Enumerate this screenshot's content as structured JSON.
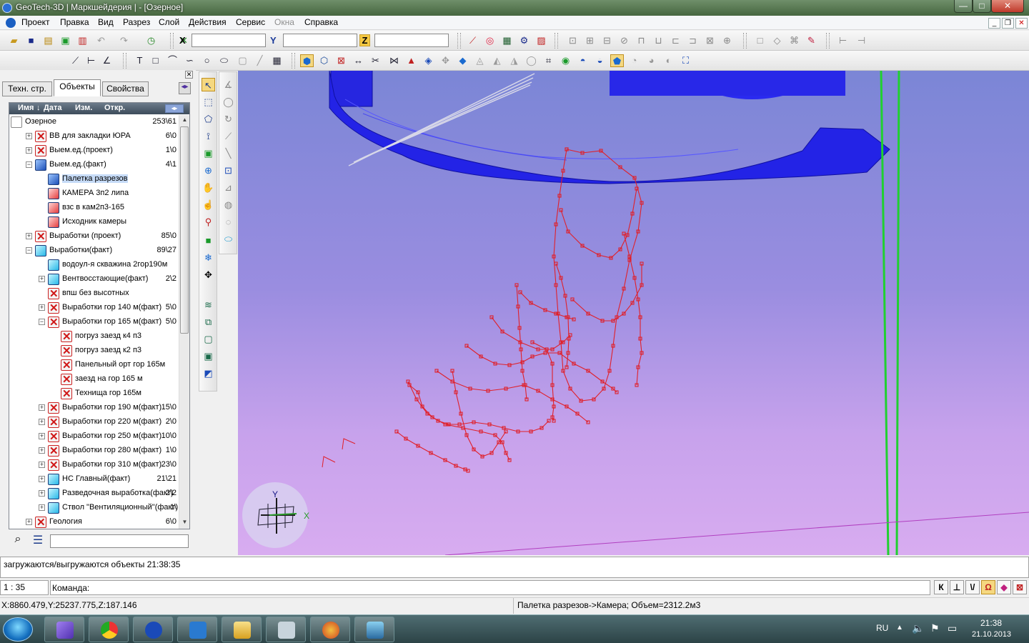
{
  "window": {
    "title": "GeoTech-3D | Маркшейдерия | - [Озерное]",
    "minimize": "—",
    "maximize": "□",
    "close": "✕"
  },
  "menu": {
    "items": [
      "Проект",
      "Правка",
      "Вид",
      "Разрез",
      "Слой",
      "Действия",
      "Сервис",
      "Окна",
      "Справка"
    ],
    "disabled": [
      "Окна"
    ],
    "mdi_min": "_",
    "mdi_restore": "❐",
    "mdi_close": "✕"
  },
  "coords": {
    "x_label": "X",
    "y_label": "Y",
    "z_label": "Z",
    "x_value": "",
    "y_value": "",
    "z_value": ""
  },
  "panel": {
    "tabs": [
      "Техн. стр.",
      "Объекты",
      "Свойства"
    ],
    "active_tab": 1,
    "header": {
      "name": "Имя",
      "date": "Дата",
      "changed": "Изм.",
      "open": "Откр."
    },
    "search_value": ""
  },
  "tree": [
    {
      "label": "Озерное",
      "count": "253\\61",
      "level": 0,
      "exp": "",
      "icon": "none"
    },
    {
      "label": "ВВ для закладки ЮРА",
      "count": "6\\0",
      "level": 1,
      "exp": "+",
      "icon": "redx"
    },
    {
      "label": "Выем.ед.(проект)",
      "count": "1\\0",
      "level": 1,
      "exp": "+",
      "icon": "redx"
    },
    {
      "label": "Выем.ед.(факт)",
      "count": "4\\1",
      "level": 1,
      "exp": "−",
      "icon": "blue"
    },
    {
      "label": "Палетка разрезов",
      "count": "",
      "level": 2,
      "exp": "",
      "icon": "blue",
      "selected": true
    },
    {
      "label": "КАМЕРА 3п2 липа",
      "count": "",
      "level": 2,
      "exp": "",
      "icon": "red"
    },
    {
      "label": "взс в кам2п3-165",
      "count": "",
      "level": 2,
      "exp": "",
      "icon": "red"
    },
    {
      "label": "Исходник камеры",
      "count": "",
      "level": 2,
      "exp": "",
      "icon": "red"
    },
    {
      "label": "Выработки (проект)",
      "count": "85\\0",
      "level": 1,
      "exp": "+",
      "icon": "redx"
    },
    {
      "label": "Выработки(факт)",
      "count": "89\\27",
      "level": 1,
      "exp": "−",
      "icon": "cyan"
    },
    {
      "label": "водоул-я скважина 2гор190м",
      "count": "",
      "level": 2,
      "exp": "",
      "icon": "cyan"
    },
    {
      "label": "Вентвосстающие(факт)",
      "count": "2\\2",
      "level": 2,
      "exp": "+",
      "icon": "cyan"
    },
    {
      "label": "впш без высотных",
      "count": "",
      "level": 2,
      "exp": "",
      "icon": "redx"
    },
    {
      "label": "Выработки гор 140 м(факт)",
      "count": "5\\0",
      "level": 2,
      "exp": "+",
      "icon": "redx"
    },
    {
      "label": "Выработки гор 165 м(факт)",
      "count": "5\\0",
      "level": 2,
      "exp": "−",
      "icon": "redx"
    },
    {
      "label": "погруз заезд к4 п3",
      "count": "",
      "level": 3,
      "exp": "",
      "icon": "redx"
    },
    {
      "label": "погруз заезд к2 п3",
      "count": "",
      "level": 3,
      "exp": "",
      "icon": "redx"
    },
    {
      "label": "Панельный орт гор 165м",
      "count": "",
      "level": 3,
      "exp": "",
      "icon": "redx"
    },
    {
      "label": "заезд на гор 165 м",
      "count": "",
      "level": 3,
      "exp": "",
      "icon": "redx"
    },
    {
      "label": "Технища гор 165м",
      "count": "",
      "level": 3,
      "exp": "",
      "icon": "redx"
    },
    {
      "label": "Выработки гор 190 м(факт)",
      "count": "15\\0",
      "level": 2,
      "exp": "+",
      "icon": "redx"
    },
    {
      "label": "Выработки гор 220 м(факт)",
      "count": "2\\0",
      "level": 2,
      "exp": "+",
      "icon": "redx"
    },
    {
      "label": "Выработки гор 250 м(факт)",
      "count": "10\\0",
      "level": 2,
      "exp": "+",
      "icon": "redx"
    },
    {
      "label": "Выработки гор 280 м(факт)",
      "count": "1\\0",
      "level": 2,
      "exp": "+",
      "icon": "redx"
    },
    {
      "label": "Выработки гор 310 м(факт)",
      "count": "23\\0",
      "level": 2,
      "exp": "+",
      "icon": "redx"
    },
    {
      "label": "НС Главный(факт)",
      "count": "21\\21",
      "level": 2,
      "exp": "+",
      "icon": "cyan"
    },
    {
      "label": "Разведочная выработка(факт)",
      "count": "2\\2",
      "level": 2,
      "exp": "+",
      "icon": "cyan"
    },
    {
      "label": "Ствол \"Вентиляционный\"(факт)",
      "count": "1\\",
      "level": 2,
      "exp": "+",
      "icon": "cyan"
    },
    {
      "label": "Геология",
      "count": "6\\0",
      "level": 1,
      "exp": "+",
      "icon": "redx"
    }
  ],
  "viewport": {
    "axis_y": "Y",
    "axis_x": "X"
  },
  "log": {
    "text": "загружаются/выгружаются объекты 21:38:35"
  },
  "command": {
    "scale": "1 : 35",
    "label": "Команда:",
    "value": ""
  },
  "cmd_buttons": [
    "К",
    "⊥",
    "\\/",
    "Ω",
    "◆",
    "⊠"
  ],
  "status": {
    "coords": "X:8860.479,Y:25237.775,Z:187.146",
    "info": "Палетка разрезов->Камера; Объем=2312.2м3"
  },
  "tray": {
    "lang": "RU",
    "time": "21:38",
    "date": "21.10.2013"
  },
  "colors": {
    "accent": "#2020e0",
    "section": "#e0202a",
    "green": "#20d030"
  }
}
